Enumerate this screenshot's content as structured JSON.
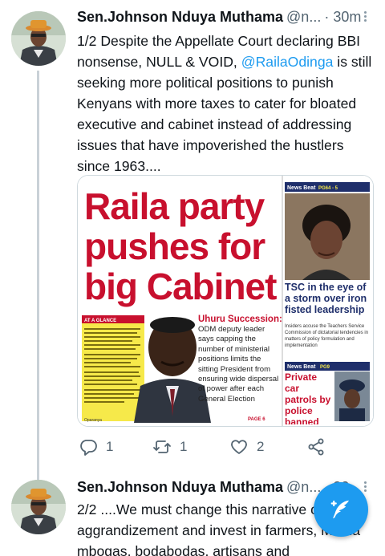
{
  "tweets": [
    {
      "name": "Sen.Johnson Nduya Muthama",
      "handle": "@n...",
      "time": "· 30m",
      "text_before": "1/2 Despite the Appellate Court declaring BBI nonsense, NULL & VOID, ",
      "mention": "@RailaOdinga",
      "text_after": " is still seeking more political positions to punish Kenyans with more taxes to cater for bloated executive and cabinet instead of addressing issues that have impoverished the hustlers since 1963....",
      "replies": "1",
      "retweets": "1",
      "likes": "2"
    },
    {
      "name": "Sen.Johnson Nduya Muthama",
      "handle": "@n...",
      "time": "· 30",
      "text": "2/2 ....We must change this narrative of self-aggrandizement and invest in farmers, Mama mbogas, bodabodas, artisans and"
    }
  ],
  "newspaper": {
    "headline_lines": [
      "Raila party",
      "pushes for",
      "big Cabinet"
    ],
    "nav_left": "News Beat",
    "nav_left_pages": "PG64 - 5",
    "side_headline": "TSC in the eye of a storm over iron fisted leadership",
    "side_body": "Insiders accuse the Teachers Service Commission of dictatorial tendencies in matters of policy formulation and implementation",
    "nav_bottom": "News Beat",
    "nav_bottom_page": "PG9",
    "bottom_headline": "Private car patrols by police banned",
    "glance_title": "AT A GLANCE",
    "succession_title": "Uhuru Succession:",
    "succession_body": "ODM deputy leader says capping the number of ministerial positions limits the sitting President from ensuring wide dispersal of power after each General Election",
    "page_ref": "PAGE 6",
    "photo_credit": "Oparanya"
  },
  "colors": {
    "accent": "#1d9bf0",
    "newspaper_red": "#c8102e",
    "glance_yellow": "#f6e94a",
    "side_blue": "#1f2f6b"
  }
}
